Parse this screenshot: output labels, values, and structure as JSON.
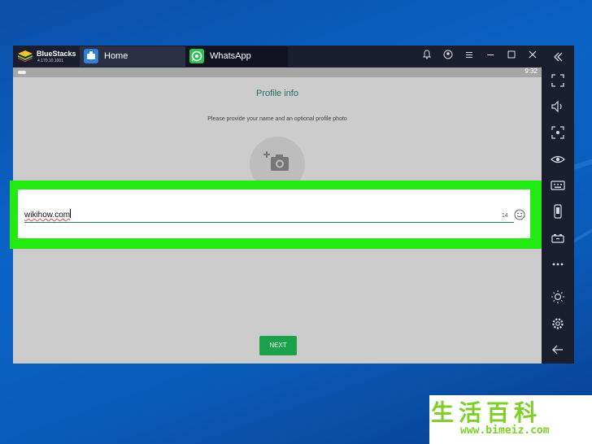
{
  "window": {
    "brand": "BlueStacks",
    "version": "4.170.10.1001",
    "tabs": [
      {
        "label": "Home"
      },
      {
        "label": "WhatsApp"
      }
    ]
  },
  "statusbar": {
    "time": "9:32"
  },
  "profile": {
    "title": "Profile info",
    "subtitle": "Please provide your name and an optional profile photo",
    "name_value": "wikihow.com",
    "char_counter": "14",
    "next_label": "NEXT"
  },
  "sidebar_icons": [
    "fullscreen-icon",
    "volume-icon",
    "screenshot-icon",
    "eye-icon",
    "keyboard-icon",
    "phone-icon",
    "gamepad-icon",
    "more-icon",
    "brightness-icon",
    "settings-icon",
    "back-icon"
  ],
  "colors": {
    "highlight": "#22ea12",
    "accent": "#1e6f5e",
    "next_button": "#1aa34a"
  },
  "watermark": {
    "chinese": "生活百科",
    "url": "www.bimeiz.com"
  }
}
